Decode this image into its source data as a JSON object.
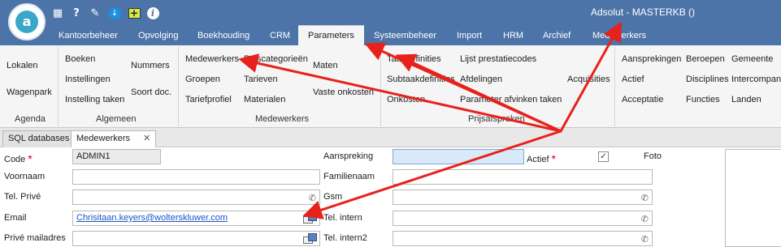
{
  "app": {
    "title": "Adsolut - MASTERKB ()",
    "logo_letter": "a"
  },
  "quick_access": [
    {
      "name": "calculator-icon",
      "glyph": "▦"
    },
    {
      "name": "help-icon",
      "glyph": "?"
    },
    {
      "name": "tools-icon",
      "glyph": "✎"
    },
    {
      "name": "download-icon",
      "glyph": "↓"
    },
    {
      "name": "add-icon",
      "glyph": "+"
    },
    {
      "name": "info-icon",
      "glyph": "i"
    }
  ],
  "menu": {
    "tabs": [
      "Kantoorbeheer",
      "Opvolging",
      "Boekhouding",
      "CRM",
      "Parameters",
      "Systeembeheer",
      "Import",
      "HRM",
      "Archief",
      "Medewerkers"
    ],
    "active": "Parameters"
  },
  "ribbon": {
    "lokalen": "Lokalen",
    "wagenpark": "Wagenpark",
    "agenda_group": "Agenda",
    "boeken": "Boeken",
    "instellingen": "Instellingen",
    "instelling_taken": "Instelling taken",
    "nummers": "Nummers",
    "soort_doc": "Soort doc.",
    "algemeen_group": "Algemeen",
    "medewerkers": "Medewerkers",
    "groepen": "Groepen",
    "tariefprofiel": "Tariefprofiel",
    "prijscategorieen": "Prijscategorieën",
    "tarieven": "Tarieven",
    "materialen": "Materialen",
    "maten": "Maten",
    "vaste_onkosten": "Vaste onkosten",
    "medewerkers_group": "Medewerkers",
    "taakdefinities": "Taakdefinities",
    "subtaakdefinities": "Subtaakdefinities",
    "onkosten": "Onkosten",
    "lijst_prestatiecodes": "Lijst prestatiecodes",
    "afdelingen": "Afdelingen",
    "parameter_afvinken": "Parameter afvinken taken",
    "prijsafspraken_group": "Prijsafspraken",
    "acquisities": "Acquisities",
    "aansprekingen": "Aansprekingen",
    "actief": "Actief",
    "acceptatie": "Acceptatie",
    "beroepen": "Beroepen",
    "disciplines": "Disciplines",
    "functies": "Functies",
    "gemeente": "Gemeente",
    "intercompany": "Intercompan",
    "landen": "Landen"
  },
  "doc_tabs": [
    {
      "label": "SQL databases",
      "active": false
    },
    {
      "label": "Medewerkers",
      "active": true,
      "close": "✕"
    }
  ],
  "form": {
    "code": {
      "label": "Code",
      "value": "ADMIN1",
      "required": "*"
    },
    "voornaam": {
      "label": "Voornaam",
      "value": ""
    },
    "tel_prive": {
      "label": "Tel. Privé",
      "value": ""
    },
    "email": {
      "label": "Email",
      "value": "Chrisitaan.keyers@wolterskluwer.com"
    },
    "prive_mail": {
      "label": "Privé mailadres",
      "value": ""
    },
    "aanspreking": {
      "label": "Aanspreking",
      "value": ""
    },
    "familienaam": {
      "label": "Familienaam",
      "value": ""
    },
    "gsm": {
      "label": "Gsm",
      "value": ""
    },
    "tel_intern": {
      "label": "Tel. intern",
      "value": ""
    },
    "tel_intern2": {
      "label": "Tel. intern2",
      "value": ""
    },
    "actief": {
      "label": "Actief",
      "required": "*",
      "checked": true,
      "check_glyph": "✓"
    },
    "foto": {
      "label": "Foto"
    }
  },
  "icons": {
    "phone": "✆"
  },
  "colors": {
    "title_bar": "#4c74a8",
    "annotation_arrow": "#e8211c",
    "required": "#d0021b",
    "link": "#1a56c2"
  }
}
